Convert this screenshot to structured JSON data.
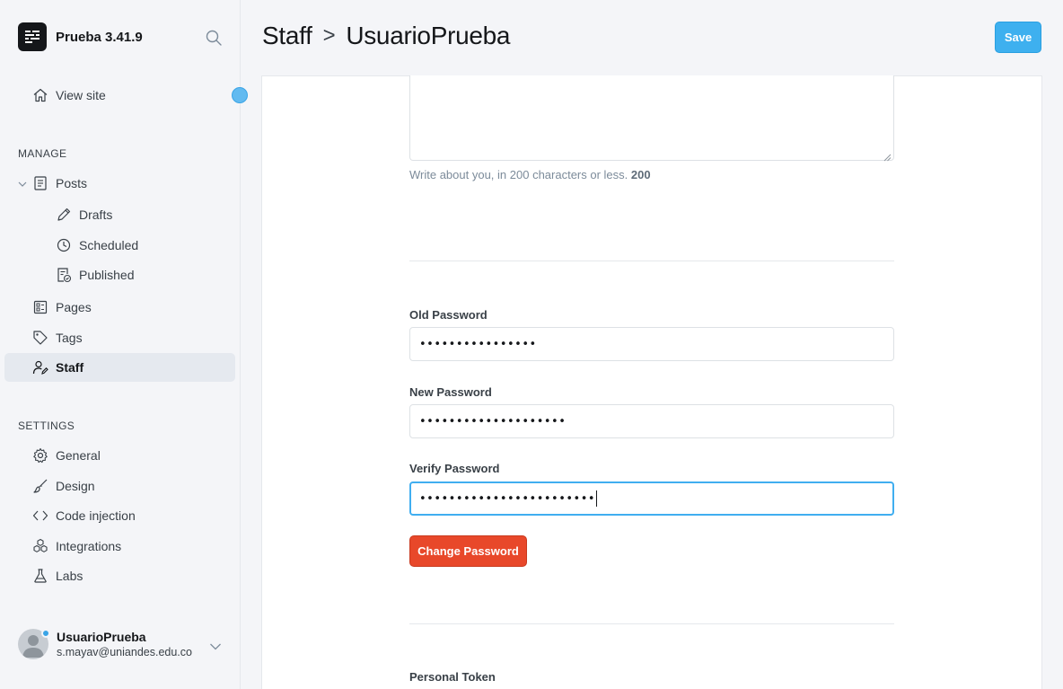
{
  "brand": {
    "name": "Prueba 3.41.9"
  },
  "sidebar": {
    "view_site": "View site",
    "manage_title": "MANAGE",
    "posts": "Posts",
    "drafts": "Drafts",
    "scheduled": "Scheduled",
    "published": "Published",
    "pages": "Pages",
    "tags": "Tags",
    "staff": "Staff",
    "settings_title": "SETTINGS",
    "general": "General",
    "design": "Design",
    "code_injection": "Code injection",
    "integrations": "Integrations",
    "labs": "Labs"
  },
  "user": {
    "name": "UsuarioPrueba",
    "email": "s.mayav@uniandes.edu.co"
  },
  "header": {
    "section": "Staff",
    "separator": ">",
    "page": "UsuarioPrueba",
    "save_label": "Save"
  },
  "bio": {
    "help_text": "Write about you, in 200 characters or less.",
    "char_count": "200"
  },
  "password": {
    "old_label": "Old Password",
    "old_value": "••••••••••••••••",
    "new_label": "New Password",
    "new_value": "••••••••••••••••••••",
    "verify_label": "Verify Password",
    "verify_value": "••••••••••••••••••••••••",
    "change_label": "Change Password"
  },
  "token": {
    "label": "Personal Token"
  },
  "colors": {
    "save_button": "#3eb0ef",
    "change_password_button": "#e8482a",
    "focus_border": "#40aef0"
  }
}
